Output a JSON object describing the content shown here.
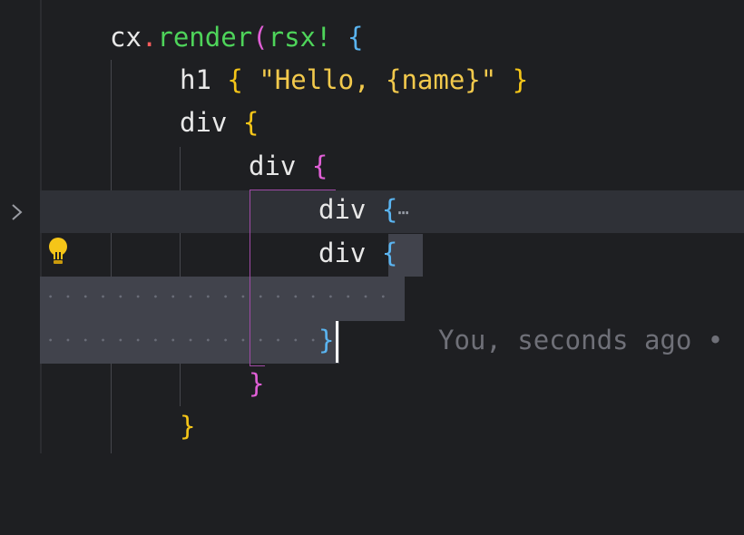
{
  "editor": {
    "lines": {
      "l1": {
        "obj": "cx",
        "dot": ".",
        "method": "render",
        "open_paren": "(",
        "macro": "rsx!",
        "open_brace": "{"
      },
      "l2": {
        "tag": "h1",
        "open_brace": "{",
        "string": "\"Hello, {name}\"",
        "close_brace": "}"
      },
      "l3": {
        "tag": "div",
        "open_brace": "{"
      },
      "l4": {
        "tag": "div",
        "open_brace": "{"
      },
      "l5": {
        "tag": "div",
        "open_brace": "{",
        "fold_marker": "⋯"
      },
      "l6": {
        "tag": "div",
        "open_brace": "{"
      },
      "l8": {
        "close_brace": "}"
      },
      "l9": {
        "close_brace": "}"
      },
      "l10": {
        "close_brace": "}"
      }
    },
    "inline_blame": "You, seconds ago •",
    "gutter": {
      "fold_icon": "chevron-right-icon",
      "code_action_icon": "lightbulb-icon"
    },
    "colors": {
      "background": "#1e1f22",
      "function": "#4ed45a",
      "string": "#f2c94c",
      "bracket_level1": "#5ab4f0",
      "bracket_level2": "#f5c518",
      "bracket_level3": "#e05fd6",
      "selection": "#41434c",
      "lightbulb": "#f5c518"
    }
  }
}
